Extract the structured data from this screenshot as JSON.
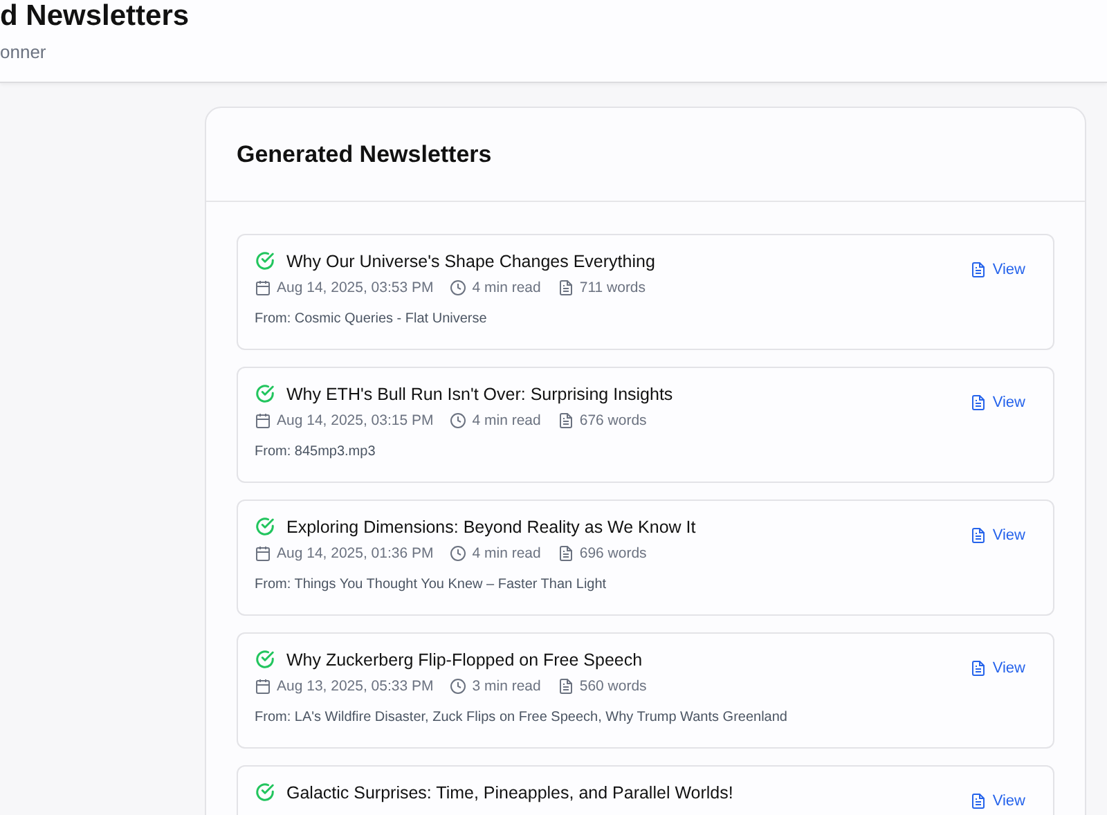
{
  "header": {
    "title": "d Newsletters",
    "subtitle": "onner"
  },
  "panel": {
    "title": "Generated Newsletters",
    "items": [
      {
        "title": "Why Our Universe's Shape Changes Everything",
        "date": "Aug 14, 2025, 03:53 PM",
        "read_time": "4 min read",
        "words": "711 words",
        "source": "From: Cosmic Queries - Flat Universe",
        "action": "View",
        "done": true
      },
      {
        "title": "Why ETH's Bull Run Isn't Over: Surprising Insights",
        "date": "Aug 14, 2025, 03:15 PM",
        "read_time": "4 min read",
        "words": "676 words",
        "source": "From: 845mp3.mp3",
        "action": "View",
        "done": true
      },
      {
        "title": "Exploring Dimensions: Beyond Reality as We Know It",
        "date": "Aug 14, 2025, 01:36 PM",
        "read_time": "4 min read",
        "words": "696 words",
        "source": "From: Things You Thought You Knew – Faster Than Light",
        "action": "View",
        "done": true
      },
      {
        "title": "Why Zuckerberg Flip-Flopped on Free Speech",
        "date": "Aug 13, 2025, 05:33 PM",
        "read_time": "3 min read",
        "words": "560 words",
        "source": "From: LA's Wildfire Disaster, Zuck Flips on Free Speech, Why Trump Wants Greenland",
        "action": "View",
        "done": true
      },
      {
        "title": "Galactic Surprises: Time, Pineapples, and Parallel Worlds!",
        "action": "View",
        "done": true
      }
    ]
  }
}
